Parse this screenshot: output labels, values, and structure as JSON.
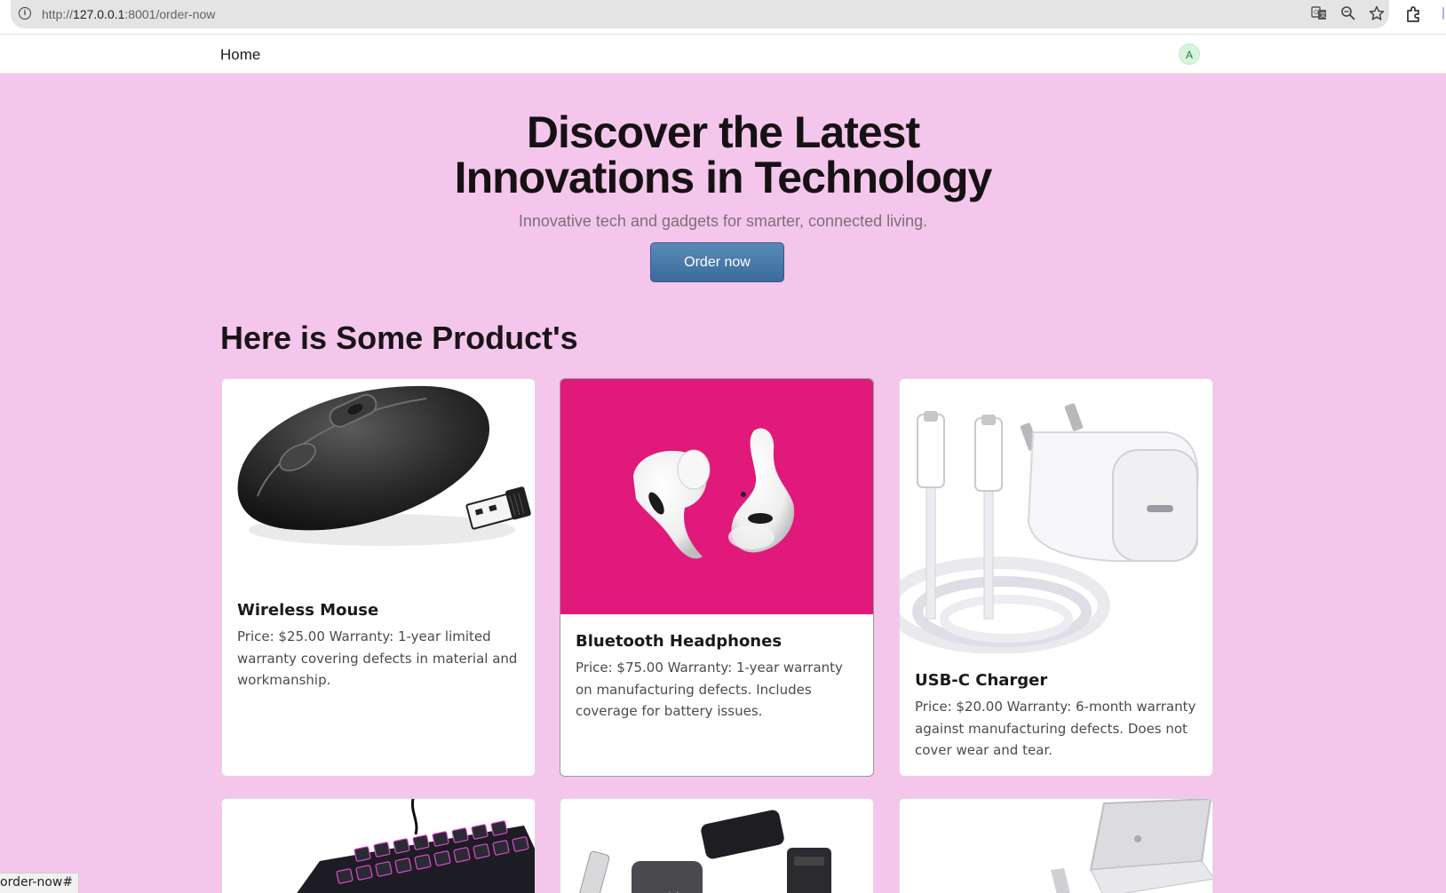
{
  "browser": {
    "url_prefix": "http://",
    "url_host": "127.0.0.1",
    "url_rest": ":8001/order-now",
    "status_url": "order-now#"
  },
  "nav": {
    "home_label": "Home",
    "avatar_initial": "A"
  },
  "hero": {
    "title_line1": "Discover the Latest",
    "title_line2": "Innovations in Technology",
    "subtitle": "Innovative tech and gadgets for smarter, connected living.",
    "cta_label": "Order now"
  },
  "products_section": {
    "title": "Here is Some Product's",
    "items": [
      {
        "name": "Wireless Mouse",
        "description": "Price: $25.00 Warranty: 1-year limited warranty covering defects in material and workmanship.",
        "image": "wireless-mouse-image"
      },
      {
        "name": "Bluetooth Headphones",
        "description": "Price: $75.00 Warranty: 1-year warranty on manufacturing defects. Includes coverage for battery issues.",
        "image": "earbuds-image"
      },
      {
        "name": "USB-C Charger",
        "description": "Price: $20.00 Warranty: 6-month warranty against manufacturing defects. Does not cover wear and tear.",
        "image": "usb-c-charger-image"
      },
      {
        "image": "rgb-keyboard-image"
      },
      {
        "image": "external-drives-image"
      },
      {
        "image": "laptop-stand-image"
      }
    ]
  },
  "colors": {
    "page_background": "#f5c6ec",
    "card_background": "#ffffff",
    "accent_button": "#4a7aab",
    "headphones_background": "#e0197a"
  }
}
